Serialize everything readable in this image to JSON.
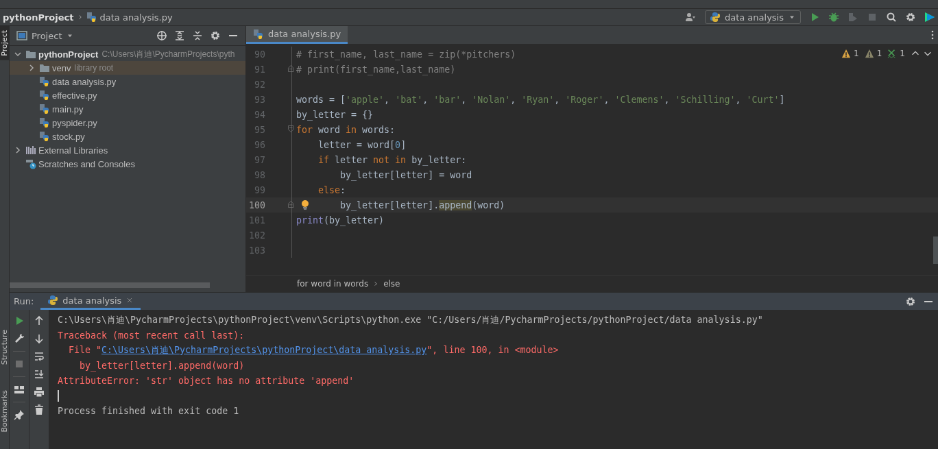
{
  "navbar": {
    "breadcrumb": [
      {
        "kind": "project",
        "label": "pythonProject"
      },
      {
        "kind": "pyfile",
        "label": "data analysis.py"
      }
    ],
    "run_config": "data analysis"
  },
  "side_tabs": [
    {
      "label": "Project",
      "selected": true
    },
    {
      "label": "Structure",
      "selected": false
    },
    {
      "label": "Bookmarks",
      "selected": false
    }
  ],
  "project_panel": {
    "title": "Project",
    "tree": [
      {
        "kind": "folder",
        "label": "pythonProject",
        "hint": "C:\\Users\\肖迪\\PycharmProjects\\pyth",
        "expanded": true,
        "selected": false,
        "children": [
          {
            "kind": "folder",
            "label": "venv",
            "hint": "library root",
            "expanded": false,
            "selected": true
          },
          {
            "kind": "pyfile",
            "label": "data analysis.py",
            "selected": false
          },
          {
            "kind": "pyfile",
            "label": "effective.py",
            "selected": false
          },
          {
            "kind": "pyfile",
            "label": "main.py",
            "selected": false
          },
          {
            "kind": "pyfile",
            "label": "pyspider.py",
            "selected": false
          },
          {
            "kind": "pyfile",
            "label": "stock.py",
            "selected": false
          }
        ]
      },
      {
        "kind": "library",
        "label": "External Libraries",
        "expanded": false,
        "selected": false
      },
      {
        "kind": "scratch",
        "label": "Scratches and Consoles",
        "selected": false
      }
    ]
  },
  "editor": {
    "tabs": [
      {
        "label": "data analysis.py",
        "selected": true
      }
    ],
    "inspections": [
      {
        "kind": "warning",
        "count": "1"
      },
      {
        "kind": "weak",
        "count": "1"
      },
      {
        "kind": "typo",
        "count": "1"
      }
    ],
    "lines": [
      {
        "number": "90",
        "current": false,
        "tokens": [
          {
            "kind": "comment",
            "text": "# first_name, last_name = zip(*pitchers)"
          }
        ]
      },
      {
        "number": "91",
        "current": false,
        "fold_end": true,
        "tokens": [
          {
            "kind": "comment",
            "text": "# print(first_name,last_name)"
          }
        ]
      },
      {
        "number": "92",
        "current": false
      },
      {
        "number": "93",
        "current": false,
        "tokens": [
          {
            "kind": "plain",
            "text": "words = ["
          },
          {
            "kind": "string",
            "text": "'apple'"
          },
          {
            "kind": "plain",
            "text": ", "
          },
          {
            "kind": "string",
            "text": "'bat'"
          },
          {
            "kind": "plain",
            "text": ", "
          },
          {
            "kind": "string",
            "text": "'bar'"
          },
          {
            "kind": "plain",
            "text": ", "
          },
          {
            "kind": "string",
            "text": "'Nolan'"
          },
          {
            "kind": "plain",
            "text": ", "
          },
          {
            "kind": "string",
            "text": "'Ryan'"
          },
          {
            "kind": "plain",
            "text": ", "
          },
          {
            "kind": "string",
            "text": "'Roger'"
          },
          {
            "kind": "plain",
            "text": ", "
          },
          {
            "kind": "string",
            "text": "'Clemens'"
          },
          {
            "kind": "plain",
            "text": ", "
          },
          {
            "kind": "string",
            "text": "'Schilling'"
          },
          {
            "kind": "plain",
            "text": ", "
          },
          {
            "kind": "string",
            "text": "'Curt'"
          },
          {
            "kind": "plain",
            "text": "]"
          }
        ]
      },
      {
        "number": "94",
        "current": false,
        "tokens": [
          {
            "kind": "plain",
            "text": "by_letter = {}"
          }
        ]
      },
      {
        "number": "95",
        "current": false,
        "fold_start": true,
        "tokens": [
          {
            "kind": "keyword",
            "text": "for "
          },
          {
            "kind": "plain",
            "text": "word "
          },
          {
            "kind": "keyword",
            "text": "in "
          },
          {
            "kind": "plain",
            "text": "words:"
          }
        ]
      },
      {
        "number": "96",
        "current": false,
        "tokens": [
          {
            "kind": "plain",
            "text": "    letter = word["
          },
          {
            "kind": "number",
            "text": "0"
          },
          {
            "kind": "plain",
            "text": "]"
          }
        ]
      },
      {
        "number": "97",
        "current": false,
        "tokens": [
          {
            "kind": "keyword",
            "text": "    if "
          },
          {
            "kind": "plain",
            "text": "letter "
          },
          {
            "kind": "keyword",
            "text": "not in "
          },
          {
            "kind": "plain",
            "text": "by_letter:"
          }
        ]
      },
      {
        "number": "98",
        "current": false,
        "tokens": [
          {
            "kind": "plain",
            "text": "        by_letter[letter] = word"
          }
        ]
      },
      {
        "number": "99",
        "current": false,
        "tokens": [
          {
            "kind": "keyword",
            "text": "    else"
          },
          {
            "kind": "plain",
            "text": ":"
          }
        ]
      },
      {
        "number": "100",
        "current": true,
        "fold_end": true,
        "bulb": true,
        "tokens": [
          {
            "kind": "plain",
            "text": "        by_letter[letter]."
          },
          {
            "kind": "highlight",
            "text": "append"
          },
          {
            "kind": "plain",
            "text": "(word)"
          }
        ]
      },
      {
        "number": "101",
        "current": false,
        "tokens": [
          {
            "kind": "builtin",
            "text": "print"
          },
          {
            "kind": "plain",
            "text": "(by_letter)"
          }
        ]
      },
      {
        "number": "102",
        "current": false
      },
      {
        "number": "103",
        "current": false
      }
    ],
    "breadcrumbs": [
      "for word in words",
      "else"
    ]
  },
  "run_panel": {
    "label": "Run:",
    "tabs": [
      {
        "label": "data analysis",
        "selected": true
      }
    ],
    "console": [
      {
        "kind": "command",
        "segments": [
          {
            "kind": "text",
            "text": "C:\\Users\\肖迪\\PycharmProjects\\pythonProject\\venv\\Scripts\\python.exe \"C:/Users/肖迪/PycharmProjects/pythonProject/data analysis.py\""
          }
        ]
      },
      {
        "kind": "error",
        "segments": [
          {
            "kind": "text",
            "text": "Traceback (most recent call last):"
          }
        ]
      },
      {
        "kind": "error",
        "segments": [
          {
            "kind": "text",
            "text": "  File \""
          },
          {
            "kind": "link",
            "text": "C:\\Users\\肖迪\\PycharmProjects\\pythonProject\\data analysis.py"
          },
          {
            "kind": "text",
            "text": "\", line 100, in <module>"
          }
        ]
      },
      {
        "kind": "error",
        "segments": [
          {
            "kind": "text",
            "text": "    by_letter[letter].append(word)"
          }
        ]
      },
      {
        "kind": "error",
        "segments": [
          {
            "kind": "text",
            "text": "AttributeError: 'str' object has no attribute 'append'"
          }
        ]
      },
      {
        "kind": "caret"
      },
      {
        "kind": "command",
        "segments": [
          {
            "kind": "text",
            "text": "Process finished with exit code 1"
          }
        ]
      }
    ]
  }
}
